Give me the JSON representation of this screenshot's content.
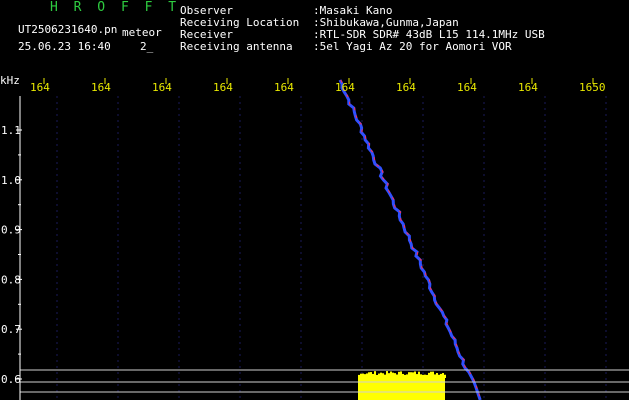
{
  "header": {
    "app_name": "H R O F F T",
    "file_name": "UT2506231640.pn",
    "file_type": "meteor",
    "date_time": "25.06.23 16:40",
    "date_suffix": "2_",
    "info": [
      {
        "label": "Observer",
        "value": ":Masaki Kano"
      },
      {
        "label": "Receiving Location",
        "value": ":Shibukawa,Gunma,Japan"
      },
      {
        "label": "Receiver",
        "value": ":RTL-SDR SDR# 43dB L15 114.1MHz USB"
      },
      {
        "label": "Receiving antenna",
        "value": ":5el Yagi Az 20 for Aomori VOR"
      }
    ]
  },
  "chart_data": {
    "type": "spectrogram",
    "ylabel": "kHz",
    "y_ticks": [
      "1.1",
      "1.0",
      "0.9",
      "0.8",
      "0.7",
      "0.6"
    ],
    "x_ticks": [
      "164",
      "164",
      "164",
      "164",
      "164",
      "164",
      "164",
      "164",
      "164",
      "1650"
    ],
    "colors": {
      "tick_text": "#e8e800",
      "axis": "#ffffff",
      "trace": "#3050ff",
      "trace_highlight": "#ff3050",
      "noise_band": "#ffff00",
      "reference_line": "#cfcfcf"
    }
  }
}
